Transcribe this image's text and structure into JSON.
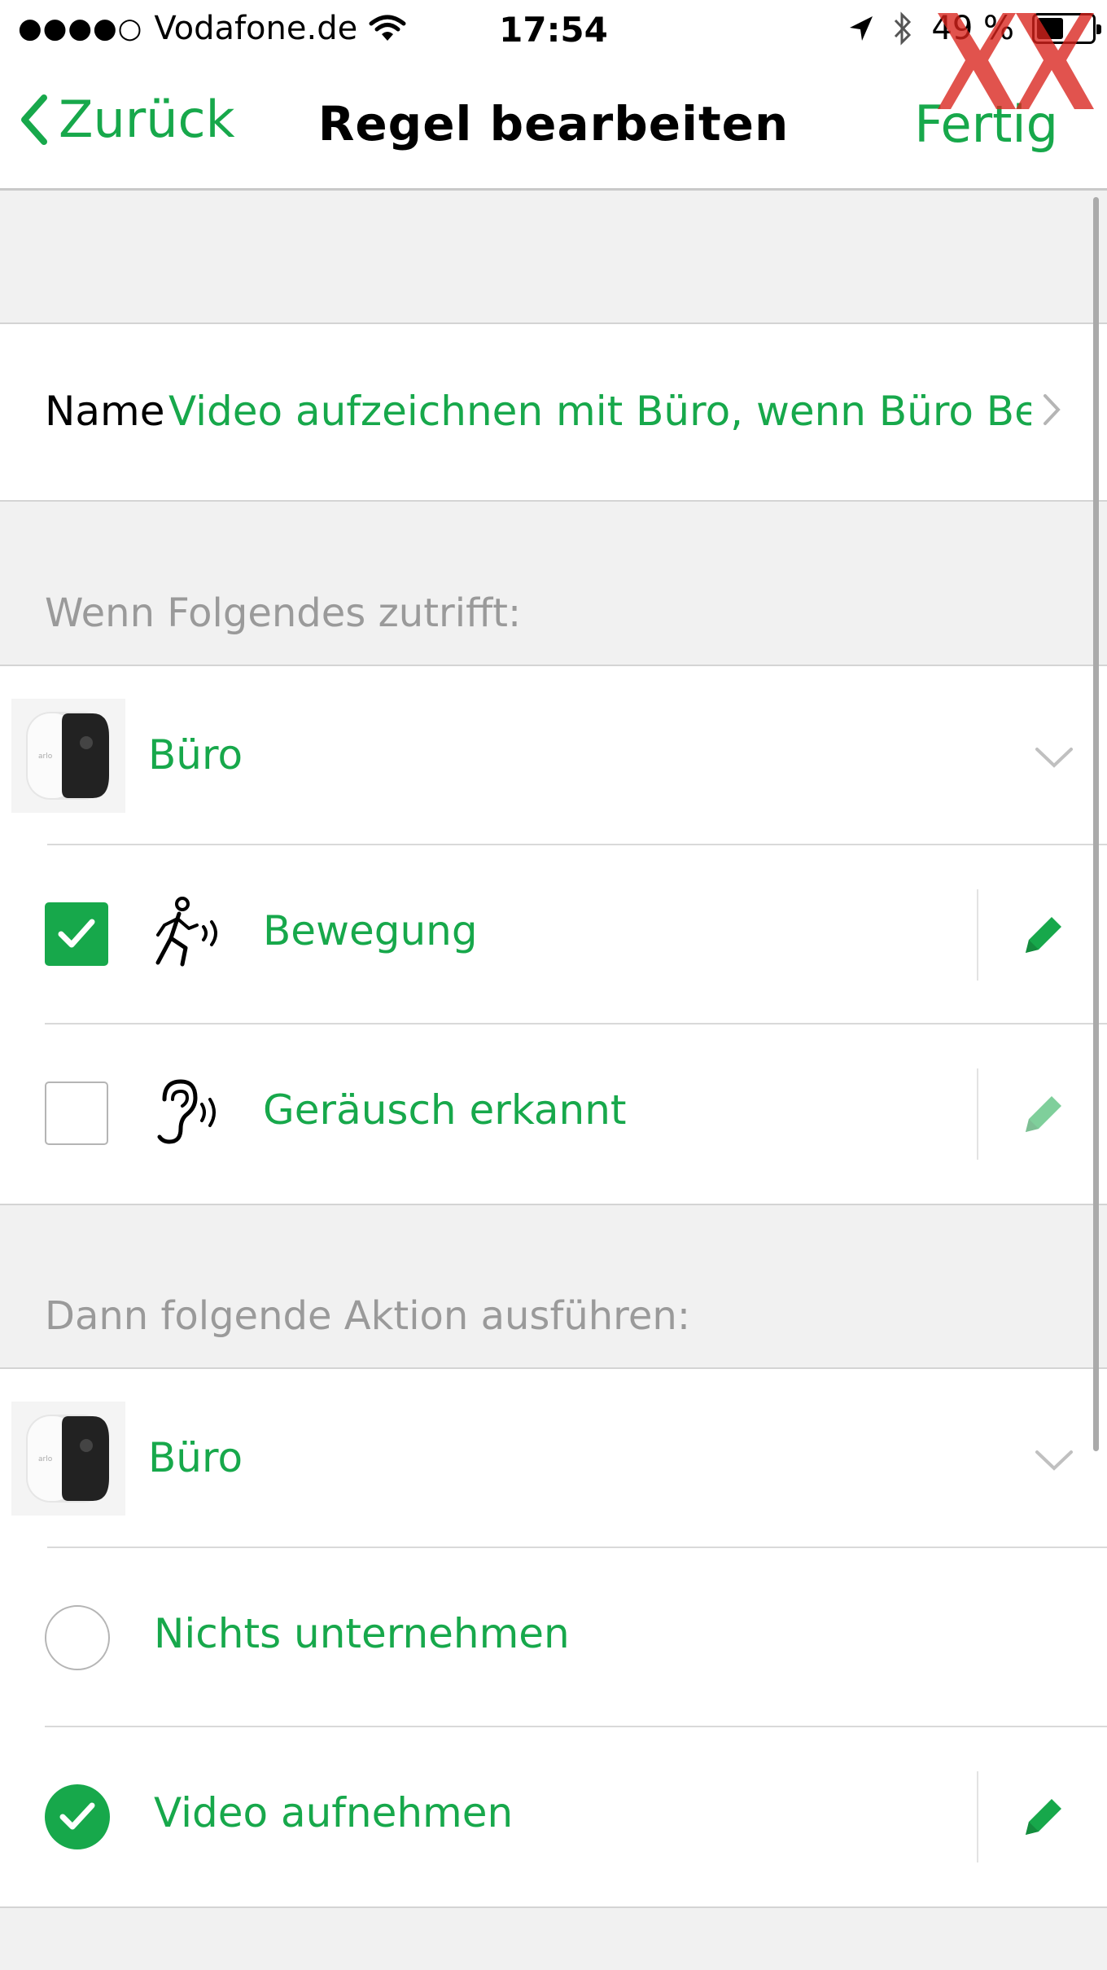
{
  "status_bar": {
    "signal_dots": "●●●●○",
    "carrier": "Vodafone.de",
    "time": "17:54",
    "battery": "49 %",
    "battery_level_percent": 49
  },
  "nav": {
    "back_label": "Zurück",
    "title": "Regel bearbeiten",
    "done_label": "Fertig"
  },
  "name_row": {
    "label": "Name",
    "value": "Video aufzeichnen mit Büro, wenn Büro Be..."
  },
  "conditions": {
    "header": "Wenn Folgendes zutrifft:",
    "device": "Büro",
    "triggers": [
      {
        "label": "Bewegung",
        "checked": true,
        "icon": "motion-icon"
      },
      {
        "label": "Geräusch erkannt",
        "checked": false,
        "icon": "ear-sound-icon"
      }
    ]
  },
  "actions": {
    "header": "Dann folgende Aktion ausführen:",
    "device": "Büro",
    "options": [
      {
        "label": "Nichts unternehmen",
        "selected": false
      },
      {
        "label": "Video aufnehmen",
        "selected": true
      }
    ]
  },
  "colors": {
    "accent": "#17a84b",
    "background": "#f1f1f1",
    "header_text": "#9a9a9a",
    "watermark": "#d9231c"
  }
}
